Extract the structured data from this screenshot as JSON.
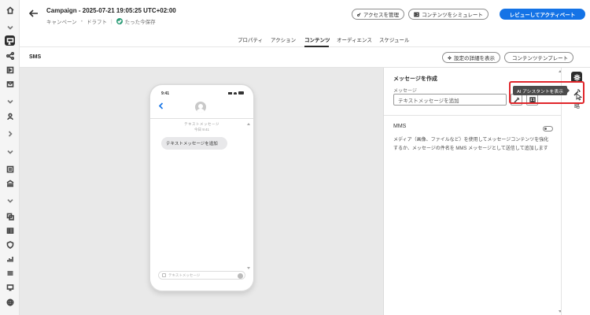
{
  "header": {
    "title": "Campaign - 2025-07-21 19:05:25 UTC+02:00",
    "breadcrumb_type": "キャンペーン",
    "breadcrumb_status": "ドラフト",
    "saved_status": "たった今保存",
    "manage_access_label": "アクセスを管理",
    "simulate_content_label": "コンテンツをシミュレート",
    "review_activate_label": "レビューしてアクティベート"
  },
  "tabs": [
    {
      "label": "プロパティ"
    },
    {
      "label": "アクション"
    },
    {
      "label": "コンテンツ",
      "active": true
    },
    {
      "label": "オーディエンス"
    },
    {
      "label": "スケジュール"
    }
  ],
  "toolbar": {
    "channel_label": "SMS",
    "show_settings_label": "設定の詳細を表示",
    "content_template_label": "コンテンツテンプレート"
  },
  "preview": {
    "time": "9:41",
    "meta_line1": "テキストメッセージ",
    "meta_line2": "今日 9:41",
    "bubble_text": "テキストメッセージを追加",
    "compose_placeholder": "テキストメッセージ"
  },
  "panel": {
    "title": "メッセージを作成",
    "message_label": "メッセージ",
    "message_value": "テキストメッセージを追加",
    "mms_title": "MMS",
    "mms_description": "メディア（画像、ファイルなど）を使用してメッセージコンテンツを強化するか、メッセージの件名を MMS メッセージとして送信して追加します",
    "mms_enabled": false
  },
  "right_rail": {
    "side_label": "略"
  },
  "tooltip": {
    "text": "AI アシスタントを表示"
  },
  "colors": {
    "primary": "#1473e6",
    "saved_green": "#2d9d78",
    "highlight_red": "#e0262b"
  }
}
